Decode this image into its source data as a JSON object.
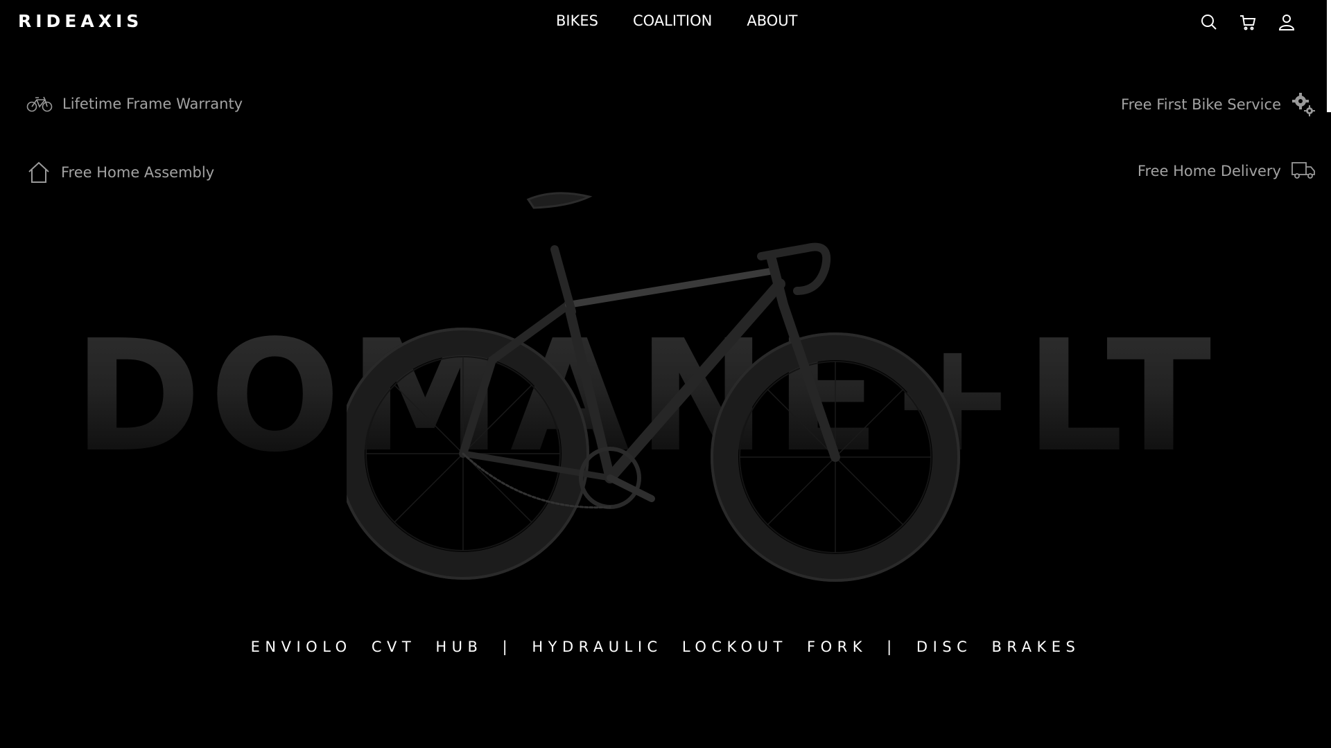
{
  "brand": {
    "logo": "RIDEAXIS"
  },
  "nav": {
    "items": [
      "BIKES",
      "COALITION",
      "ABOUT"
    ]
  },
  "header_icons": [
    "search-icon",
    "cart-icon",
    "user-icon"
  ],
  "features": {
    "warranty": {
      "label": "Lifetime Frame Warranty",
      "icon": "bicycle-icon"
    },
    "assembly": {
      "label": "Free Home Assembly",
      "icon": "home-icon"
    },
    "service": {
      "label": "Free First Bike Service",
      "icon": "gears-icon"
    },
    "delivery": {
      "label": "Free Home Delivery",
      "icon": "truck-icon"
    }
  },
  "hero": {
    "model_name": "DOMANE+LT",
    "specs": "ENVIOLO CVT HUB | HYDRAULIC LOCKOUT FORK | DISC BRAKES"
  },
  "colors": {
    "background": "#000000",
    "text": "#ffffff",
    "feature_text": "#a3a3a3"
  }
}
